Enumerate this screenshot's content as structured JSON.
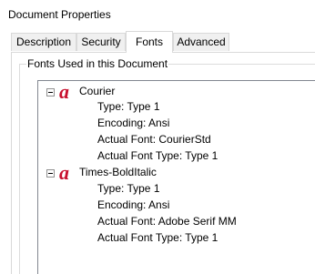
{
  "window": {
    "title": "Document Properties"
  },
  "tabs": [
    {
      "label": "Description"
    },
    {
      "label": "Security"
    },
    {
      "label": "Fonts"
    },
    {
      "label": "Advanced"
    }
  ],
  "fonts_group": {
    "label": "Fonts Used in this Document"
  },
  "fonts": [
    {
      "name": "Courier",
      "props": [
        "Type: Type 1",
        "Encoding: Ansi",
        "Actual Font: CourierStd",
        "Actual Font Type: Type 1"
      ]
    },
    {
      "name": "Times-BoldItalic",
      "props": [
        "Type: Type 1",
        "Encoding: Ansi",
        "Actual Font: Adobe Serif MM",
        "Actual Font Type: Type 1"
      ]
    }
  ],
  "icons": {
    "font": "acrobat-font-icon"
  },
  "colors": {
    "font_icon": "#c8102e"
  }
}
